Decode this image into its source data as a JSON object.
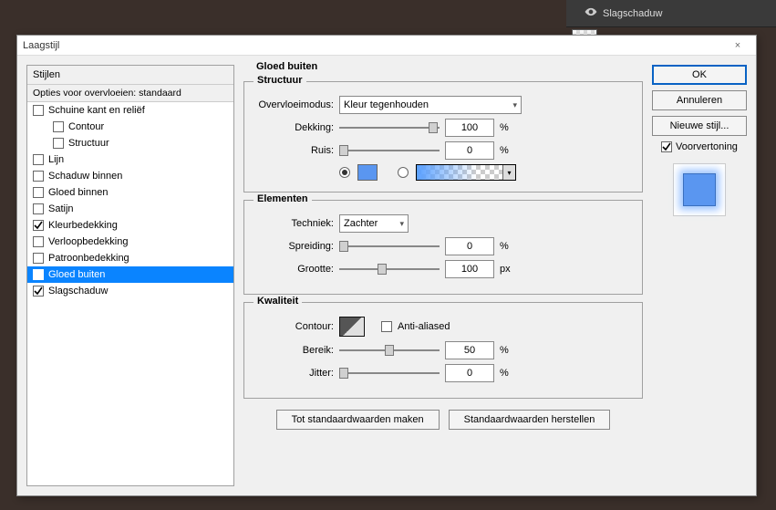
{
  "bg": {
    "layer_name": "Slagschaduw"
  },
  "dialog": {
    "title": "Laagstijl",
    "close": "×",
    "left": {
      "header": "Stijlen",
      "blend_opts": "Opties voor overvloeien: standaard",
      "items": [
        {
          "label": "Schuine kant en reliëf",
          "checked": false,
          "indent": false
        },
        {
          "label": "Contour",
          "checked": false,
          "indent": true
        },
        {
          "label": "Structuur",
          "checked": false,
          "indent": true
        },
        {
          "label": "Lijn",
          "checked": false,
          "indent": false
        },
        {
          "label": "Schaduw binnen",
          "checked": false,
          "indent": false
        },
        {
          "label": "Gloed binnen",
          "checked": false,
          "indent": false
        },
        {
          "label": "Satijn",
          "checked": false,
          "indent": false
        },
        {
          "label": "Kleurbedekking",
          "checked": true,
          "indent": false
        },
        {
          "label": "Verloopbedekking",
          "checked": false,
          "indent": false
        },
        {
          "label": "Patroonbedekking",
          "checked": false,
          "indent": false
        },
        {
          "label": "Gloed buiten",
          "checked": true,
          "indent": false,
          "selected": true
        },
        {
          "label": "Slagschaduw",
          "checked": true,
          "indent": false
        }
      ]
    },
    "mid": {
      "panel_title": "Gloed buiten",
      "structure": {
        "legend": "Structuur",
        "blendmode_label": "Overvloeimodus:",
        "blendmode_value": "Kleur tegenhouden",
        "opacity_label": "Dekking:",
        "opacity_value": "100",
        "opacity_unit": "%",
        "noise_label": "Ruis:",
        "noise_value": "0",
        "noise_unit": "%",
        "color_hex": "#5a96f0"
      },
      "elements": {
        "legend": "Elementen",
        "technique_label": "Techniek:",
        "technique_value": "Zachter",
        "spread_label": "Spreiding:",
        "spread_value": "0",
        "spread_unit": "%",
        "size_label": "Grootte:",
        "size_value": "100",
        "size_unit": "px"
      },
      "quality": {
        "legend": "Kwaliteit",
        "contour_label": "Contour:",
        "aa_label": "Anti-aliased",
        "aa_checked": false,
        "range_label": "Bereik:",
        "range_value": "50",
        "range_unit": "%",
        "jitter_label": "Jitter:",
        "jitter_value": "0",
        "jitter_unit": "%"
      },
      "footer": {
        "make_default": "Tot standaardwaarden maken",
        "reset_default": "Standaardwaarden herstellen"
      }
    },
    "right": {
      "ok": "OK",
      "cancel": "Annuleren",
      "new_style": "Nieuwe stijl...",
      "preview_label": "Voorvertoning",
      "preview_checked": true
    }
  }
}
